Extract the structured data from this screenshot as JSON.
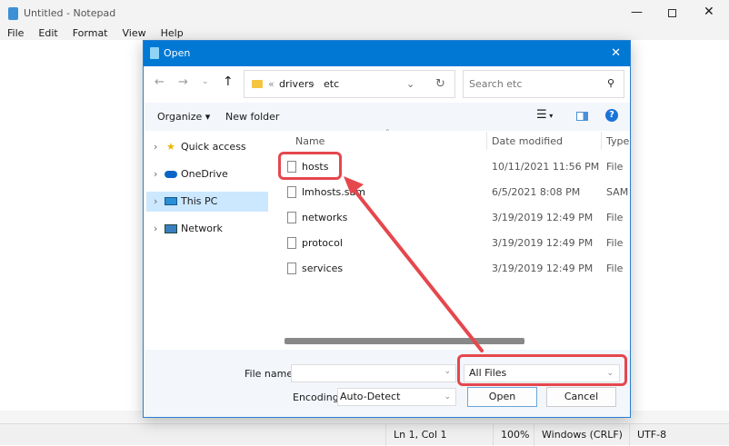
{
  "notepad": {
    "title": "Untitled - Notepad",
    "menu": [
      "File",
      "Edit",
      "Format",
      "View",
      "Help"
    ],
    "status": {
      "position": "Ln 1, Col 1",
      "zoom": "100%",
      "line_ending": "Windows (CRLF)",
      "encoding": "UTF-8"
    }
  },
  "dialog": {
    "title": "Open",
    "path": [
      "drivers",
      "etc"
    ],
    "search_placeholder": "Search etc",
    "toolbar": {
      "organize": "Organize",
      "new_folder": "New folder"
    },
    "sidebar": [
      {
        "label": "Quick access",
        "icon": "star-icon"
      },
      {
        "label": "OneDrive",
        "icon": "cloud-icon"
      },
      {
        "label": "This PC",
        "icon": "computer-icon",
        "selected": true
      },
      {
        "label": "Network",
        "icon": "network-icon"
      }
    ],
    "columns": [
      "Name",
      "Date modified",
      "Type"
    ],
    "files": [
      {
        "name": "hosts",
        "date": "10/11/2021 11:56 PM",
        "type": "File"
      },
      {
        "name": "lmhosts.sam",
        "date": "6/5/2021 8:08 PM",
        "type": "SAM"
      },
      {
        "name": "networks",
        "date": "3/19/2019 12:49 PM",
        "type": "File"
      },
      {
        "name": "protocol",
        "date": "3/19/2019 12:49 PM",
        "type": "File"
      },
      {
        "name": "services",
        "date": "3/19/2019 12:49 PM",
        "type": "File"
      }
    ],
    "file_name_label": "File name:",
    "file_name_value": "",
    "file_type": "All Files",
    "encoding_label": "Encoding:",
    "encoding_value": "Auto-Detect",
    "open": "Open",
    "cancel": "Cancel"
  },
  "colors": {
    "accent": "#0078d4",
    "highlight": "#e5474d",
    "selected": "#cce8ff"
  }
}
